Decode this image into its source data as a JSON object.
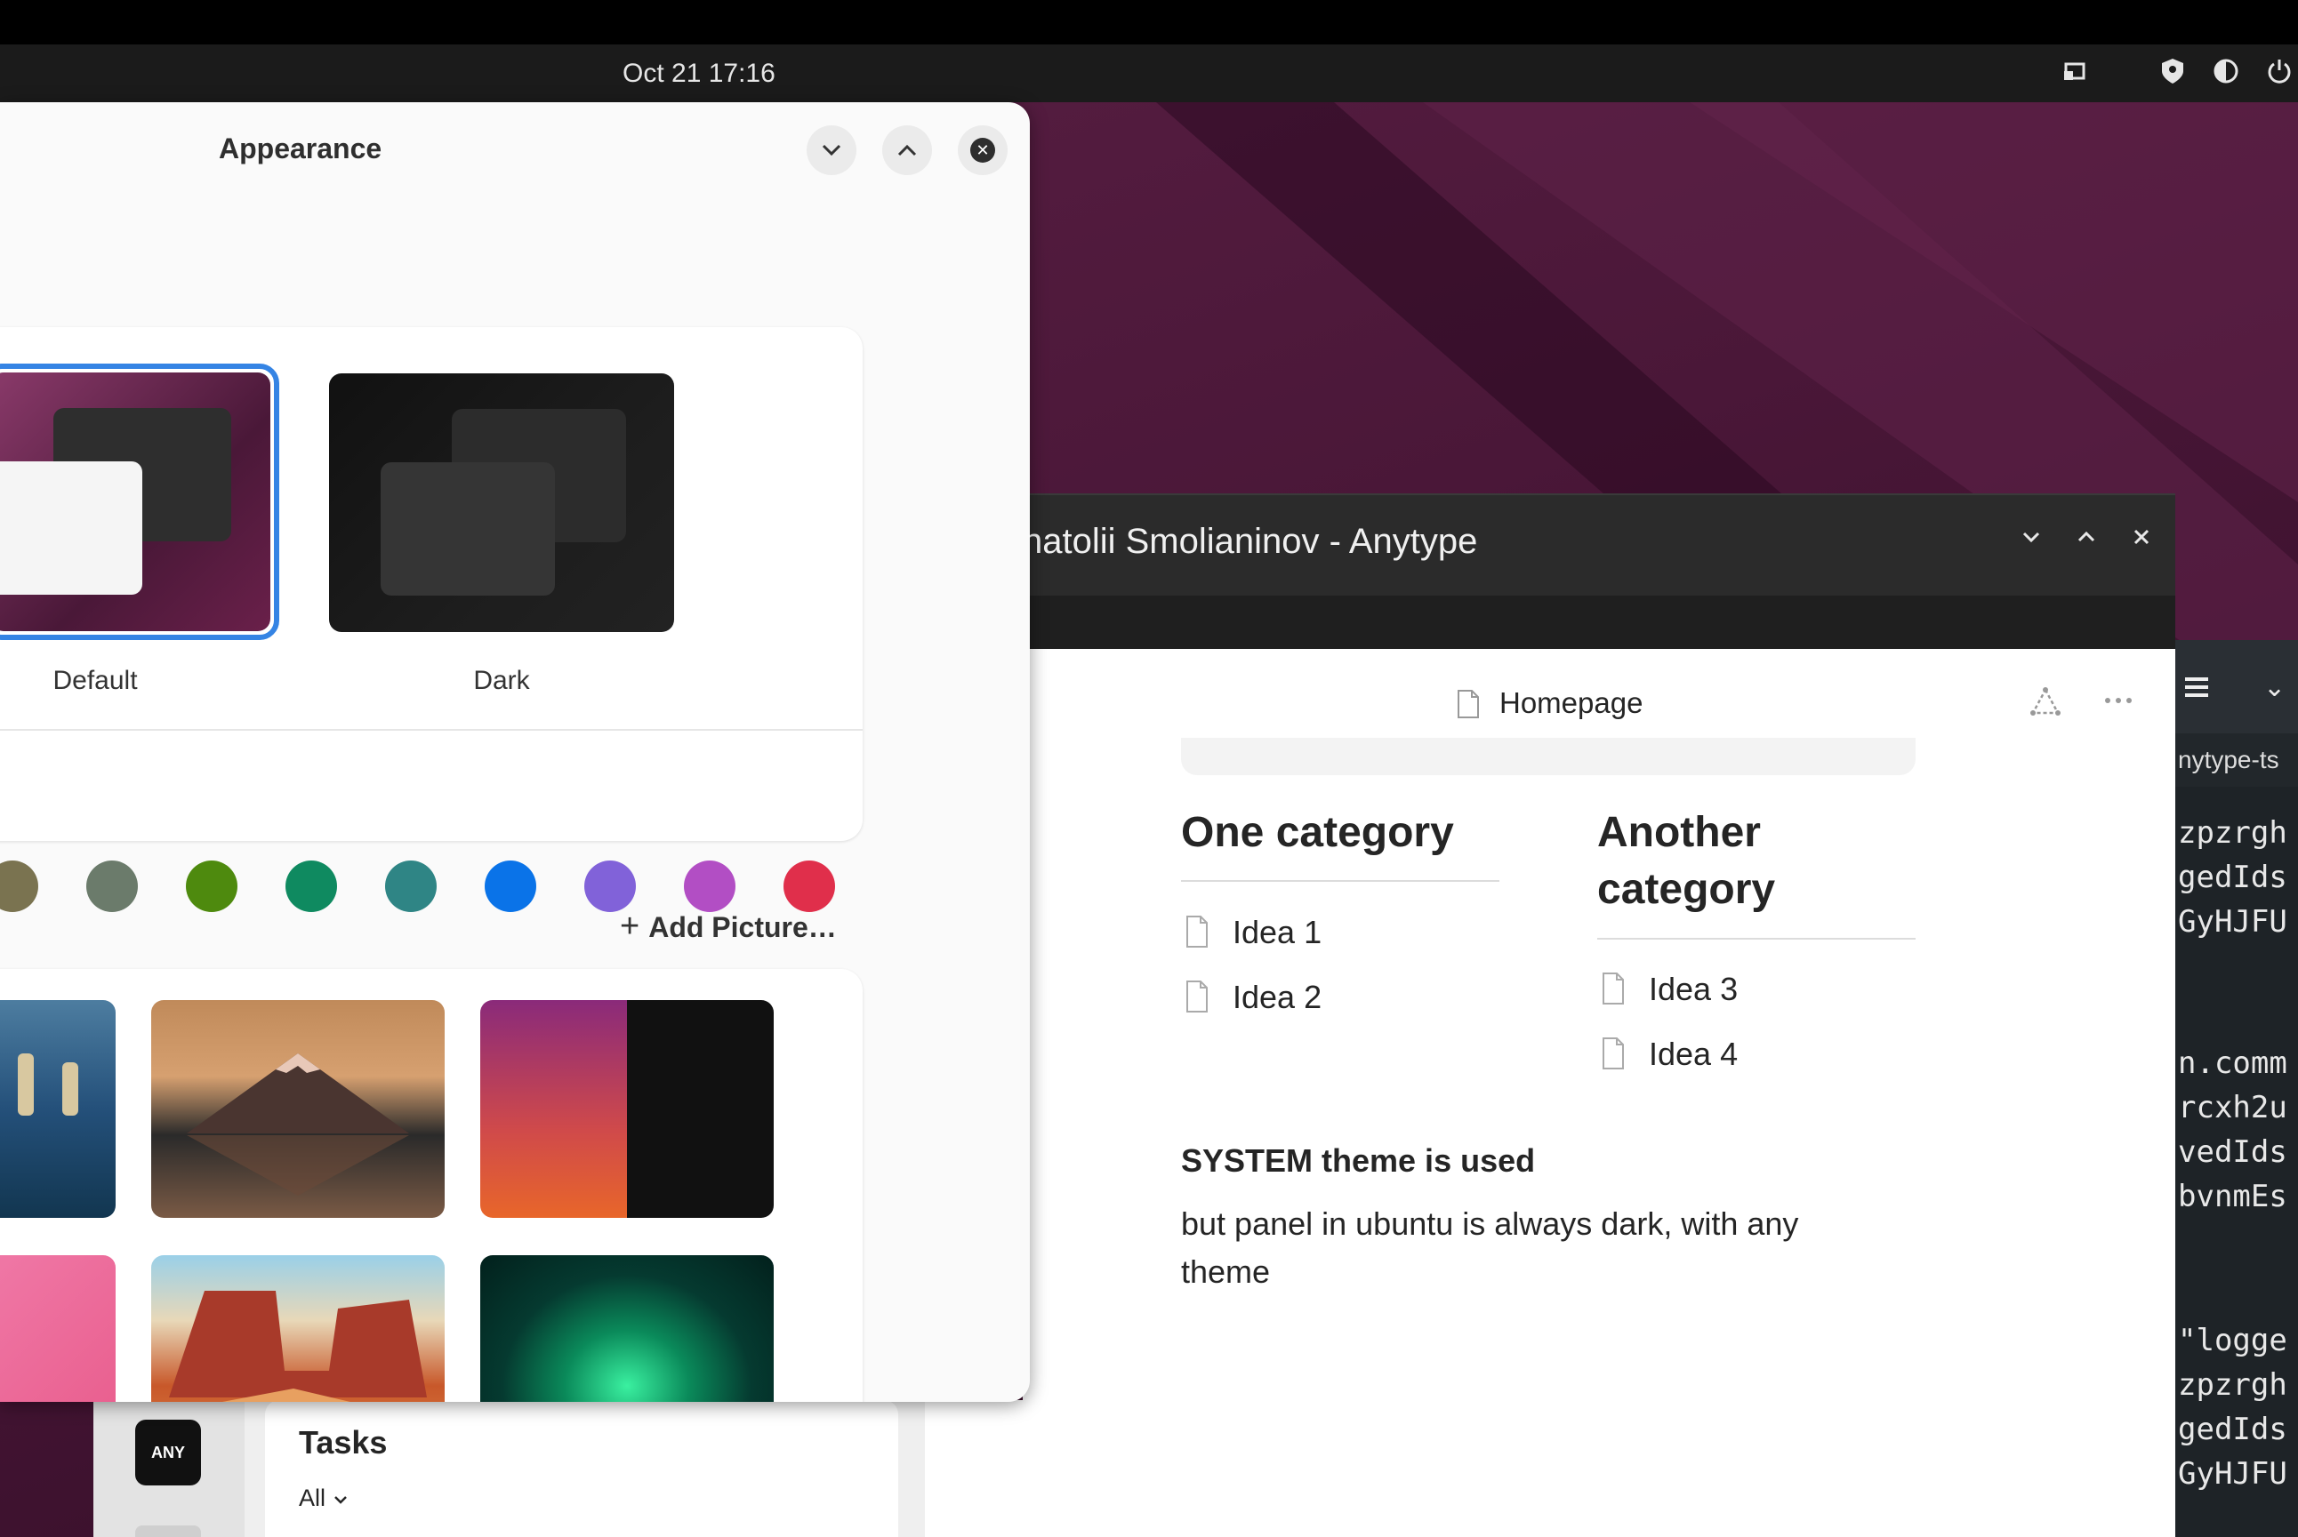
{
  "topbar": {
    "clock": "Oct 21  17:16",
    "tray_icons": [
      "screen-share-icon",
      "shield-icon",
      "volume-icon",
      "power-icon"
    ]
  },
  "appearance": {
    "title": "Appearance",
    "styles": [
      {
        "label": "Default",
        "selected": true
      },
      {
        "label": "Dark",
        "selected": false
      }
    ],
    "accent_colors": [
      "#7a7350",
      "#6b7b6b",
      "#4e8a0e",
      "#0f8a60",
      "#2f8585",
      "#0a73e8",
      "#8162d9",
      "#b24ec4",
      "#e02f4b"
    ],
    "add_picture_label": "Add Picture…",
    "wallpapers": [
      "shore-birds",
      "mount-fuji",
      "ubuntu-cat-split",
      "pink-sparkle",
      "desert-mesa",
      "aurora"
    ]
  },
  "anytype": {
    "window_title": "natolii Smolianinov - Anytype",
    "header_title": "Homepage",
    "categories": [
      {
        "title": "One category",
        "ideas": [
          "Idea 1",
          "Idea 2"
        ]
      },
      {
        "title": "Another category",
        "ideas": [
          "Idea 3",
          "Idea 4"
        ]
      }
    ],
    "system_title": "SYSTEM theme is used",
    "system_body": "but panel in ubuntu is always dark, with any theme",
    "widget_logo": "ANY",
    "widget_title": "Tasks",
    "widget_filter": "All"
  },
  "terminal": {
    "tab": "nytype-ts",
    "lines": [
      "zpzrgh",
      "gedIds",
      "GyHJFU",
      "",
      "n.comm",
      "rcxh2u",
      "vedIds",
      "bvnmEs",
      "",
      "\"logge",
      "zpzrgh",
      "gedIds",
      "GyHJFU"
    ]
  }
}
